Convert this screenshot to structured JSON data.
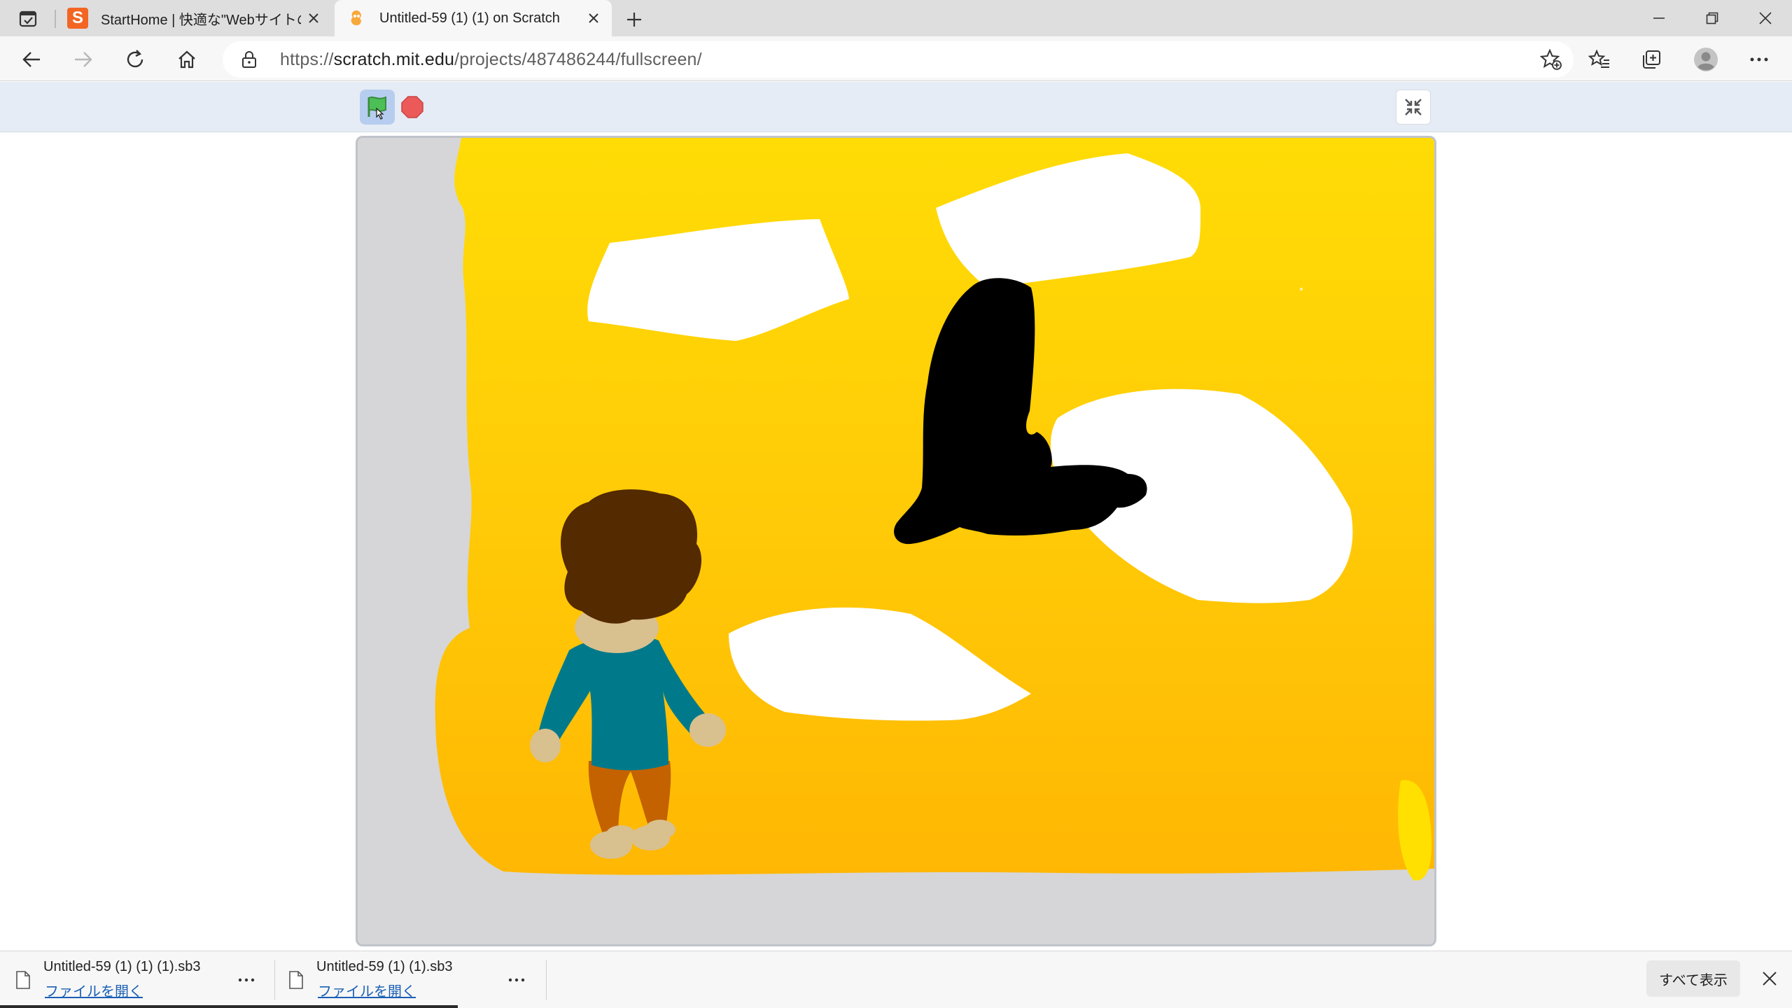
{
  "browser": {
    "tabs": [
      {
        "title": "StartHome | 快適な\"Webサイトの入口\"",
        "favicon": "S",
        "active": false
      },
      {
        "title": "Untitled-59 (1) (1) on Scratch",
        "active": true
      }
    ],
    "url": {
      "scheme": "https://",
      "host": "scratch.mit.edu",
      "path": "/projects/487486244/fullscreen/"
    }
  },
  "scratch": {
    "accent_flag": "#4cbf56",
    "accent_stop": "#ec5959"
  },
  "downloads": {
    "items": [
      {
        "filename": "Untitled-59 (1) (1) (1).sb3",
        "action": "ファイルを開く"
      },
      {
        "filename": "Untitled-59 (1) (1).sb3",
        "action": "ファイルを開く"
      }
    ],
    "show_all_label": "すべて表示"
  },
  "icons": {
    "tab_actions": "tab-actions-icon",
    "back": "back-arrow-icon",
    "forward": "forward-arrow-icon",
    "refresh": "refresh-icon",
    "home": "home-icon",
    "lock": "lock-icon",
    "add_favorite": "star-add-icon",
    "favorites": "favorites-icon",
    "collections": "collections-icon",
    "profile": "profile-icon",
    "more": "more-icon"
  }
}
